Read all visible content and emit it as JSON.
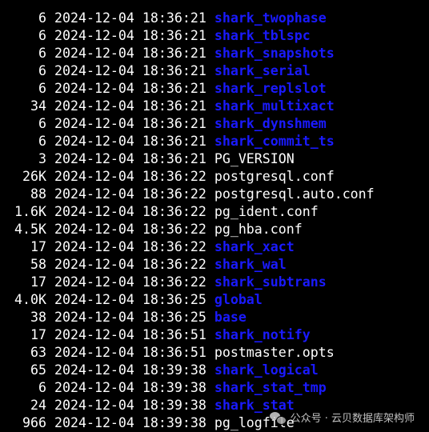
{
  "listing": [
    {
      "size": "6",
      "date": "2024-12-04",
      "time": "18:36:21",
      "name": "shark_twophase",
      "color": "#1a1aff"
    },
    {
      "size": "6",
      "date": "2024-12-04",
      "time": "18:36:21",
      "name": "shark_tblspc",
      "color": "#1a1aff"
    },
    {
      "size": "6",
      "date": "2024-12-04",
      "time": "18:36:21",
      "name": "shark_snapshots",
      "color": "#1a1aff"
    },
    {
      "size": "6",
      "date": "2024-12-04",
      "time": "18:36:21",
      "name": "shark_serial",
      "color": "#1a1aff"
    },
    {
      "size": "6",
      "date": "2024-12-04",
      "time": "18:36:21",
      "name": "shark_replslot",
      "color": "#1a1aff"
    },
    {
      "size": "34",
      "date": "2024-12-04",
      "time": "18:36:21",
      "name": "shark_multixact",
      "color": "#1a1aff"
    },
    {
      "size": "6",
      "date": "2024-12-04",
      "time": "18:36:21",
      "name": "shark_dynshmem",
      "color": "#1a1aff"
    },
    {
      "size": "6",
      "date": "2024-12-04",
      "time": "18:36:21",
      "name": "shark_commit_ts",
      "color": "#1a1aff"
    },
    {
      "size": "3",
      "date": "2024-12-04",
      "time": "18:36:21",
      "name": "PG_VERSION",
      "color": "#ffffff"
    },
    {
      "size": "26K",
      "date": "2024-12-04",
      "time": "18:36:22",
      "name": "postgresql.conf",
      "color": "#ffffff"
    },
    {
      "size": "88",
      "date": "2024-12-04",
      "time": "18:36:22",
      "name": "postgresql.auto.conf",
      "color": "#ffffff"
    },
    {
      "size": "1.6K",
      "date": "2024-12-04",
      "time": "18:36:22",
      "name": "pg_ident.conf",
      "color": "#ffffff"
    },
    {
      "size": "4.5K",
      "date": "2024-12-04",
      "time": "18:36:22",
      "name": "pg_hba.conf",
      "color": "#ffffff"
    },
    {
      "size": "17",
      "date": "2024-12-04",
      "time": "18:36:22",
      "name": "shark_xact",
      "color": "#1a1aff"
    },
    {
      "size": "58",
      "date": "2024-12-04",
      "time": "18:36:22",
      "name": "shark_wal",
      "color": "#1a1aff"
    },
    {
      "size": "17",
      "date": "2024-12-04",
      "time": "18:36:22",
      "name": "shark_subtrans",
      "color": "#1a1aff"
    },
    {
      "size": "4.0K",
      "date": "2024-12-04",
      "time": "18:36:25",
      "name": "global",
      "color": "#1a1aff"
    },
    {
      "size": "38",
      "date": "2024-12-04",
      "time": "18:36:25",
      "name": "base",
      "color": "#1a1aff"
    },
    {
      "size": "17",
      "date": "2024-12-04",
      "time": "18:36:51",
      "name": "shark_notify",
      "color": "#1a1aff"
    },
    {
      "size": "63",
      "date": "2024-12-04",
      "time": "18:36:51",
      "name": "postmaster.opts",
      "color": "#ffffff"
    },
    {
      "size": "65",
      "date": "2024-12-04",
      "time": "18:39:38",
      "name": "shark_logical",
      "color": "#1a1aff"
    },
    {
      "size": "6",
      "date": "2024-12-04",
      "time": "18:39:38",
      "name": "shark_stat_tmp",
      "color": "#1a1aff"
    },
    {
      "size": "24",
      "date": "2024-12-04",
      "time": "18:39:38",
      "name": "shark_stat",
      "color": "#1a1aff"
    },
    {
      "size": "966",
      "date": "2024-12-04",
      "time": "18:39:38",
      "name": "pg_logfile",
      "color": "#ffffff"
    }
  ],
  "watermark": {
    "text": "公众号 · 云贝数据库架构师",
    "icon": "wechat-icon"
  },
  "theme": {
    "background": "#000000",
    "text": "#ffffff",
    "directory": "#1a1aff"
  }
}
